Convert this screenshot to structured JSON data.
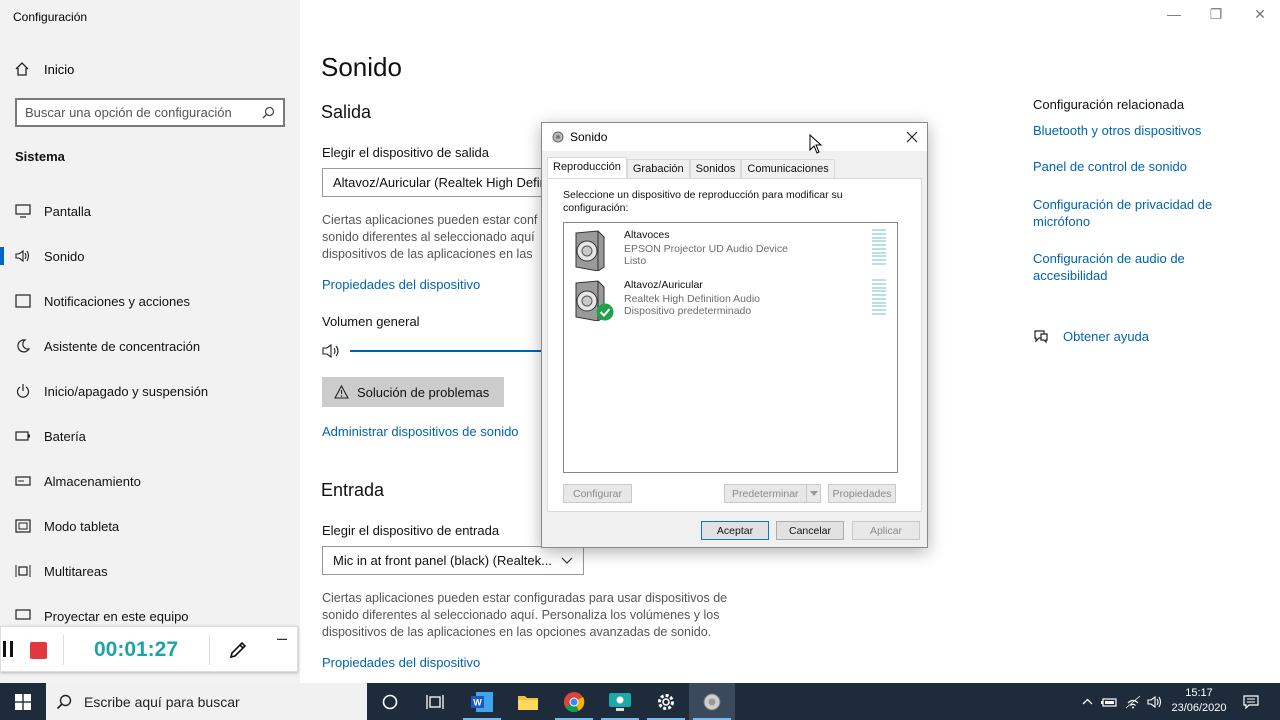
{
  "window": {
    "title": "Configuración"
  },
  "sidebar": {
    "home": "Inicio",
    "search_placeholder": "Buscar una opción de configuración",
    "section": "Sistema",
    "items": [
      {
        "label": "Pantalla",
        "icon": "monitor-icon"
      },
      {
        "label": "Sonido",
        "icon": "speaker-icon",
        "active": true
      },
      {
        "label": "Notificaciones y acciones",
        "icon": "notification-icon"
      },
      {
        "label": "Asistente de concentración",
        "icon": "moon-icon"
      },
      {
        "label": "Inicio/apagado y suspensión",
        "icon": "power-icon"
      },
      {
        "label": "Batería",
        "icon": "battery-icon"
      },
      {
        "label": "Almacenamiento",
        "icon": "storage-icon"
      },
      {
        "label": "Modo tableta",
        "icon": "tablet-icon"
      },
      {
        "label": "Multitareas",
        "icon": "multitask-icon"
      },
      {
        "label": "Proyectar en este equipo",
        "icon": "project-icon"
      }
    ]
  },
  "main": {
    "title": "Sonido",
    "output": {
      "heading": "Salida",
      "device_label": "Elegir el dispositivo de salida",
      "device_value": "Altavoz/Auricular (Realtek High Defin",
      "description": "Ciertas aplicaciones pueden estar conf sonido diferentes al seleccionado aquí dispositivos de las aplicaciones en las",
      "properties_link": "Propiedades del dispositivo",
      "volume_label": "Volumen general",
      "troubleshoot": "Solución de problemas",
      "manage_link": "Administrar dispositivos de sonido"
    },
    "input": {
      "heading": "Entrada",
      "device_label": "Elegir el dispositivo de entrada",
      "device_value": "Mic in at front panel (black) (Realtek...",
      "description": "Ciertas aplicaciones pueden estar configuradas para usar dispositivos de sonido diferentes al seleccionado aquí. Personaliza los volúmenes y los dispositivos de las aplicaciones en las opciones avanzadas de sonido.",
      "properties_link": "Propiedades del dispositivo"
    }
  },
  "related": {
    "title": "Configuración relacionada",
    "links": [
      "Bluetooth y otros dispositivos",
      "Panel de control de sonido",
      "Configuración de privacidad de micrófono",
      "Configuración de audio de accesibilidad"
    ],
    "help": "Obtener ayuda"
  },
  "recorder": {
    "time": "00:01:27"
  },
  "dialog": {
    "title": "Sonido",
    "tabs": [
      "Reproducción",
      "Grabación",
      "Sonidos",
      "Comunicaciones"
    ],
    "instruction": "Seleccione un dispositivo de reproducción para modificar su configuración:",
    "devices": [
      {
        "name": "Altavoces",
        "desc": "EPSON Projector UD Audio Device",
        "status": "Listo",
        "default": false
      },
      {
        "name": "Altavoz/Auricular",
        "desc": "Realtek High Definition Audio",
        "status": "Dispositivo predeterminado",
        "default": true
      }
    ],
    "buttons": {
      "configure": "Configurar",
      "set_default": "Predeterminar",
      "properties": "Propiedades",
      "ok": "Aceptar",
      "cancel": "Cancelar",
      "apply": "Aplicar"
    }
  },
  "taskbar": {
    "search_placeholder": "Escribe aquí para buscar",
    "time": "15:17",
    "date": "23/06/2020"
  },
  "colors": {
    "accent": "#0067c0",
    "link": "#0063b1",
    "taskbar": "#1d2b3a",
    "recorder_time": "#1ea3a6",
    "stop": "#e0383e"
  }
}
